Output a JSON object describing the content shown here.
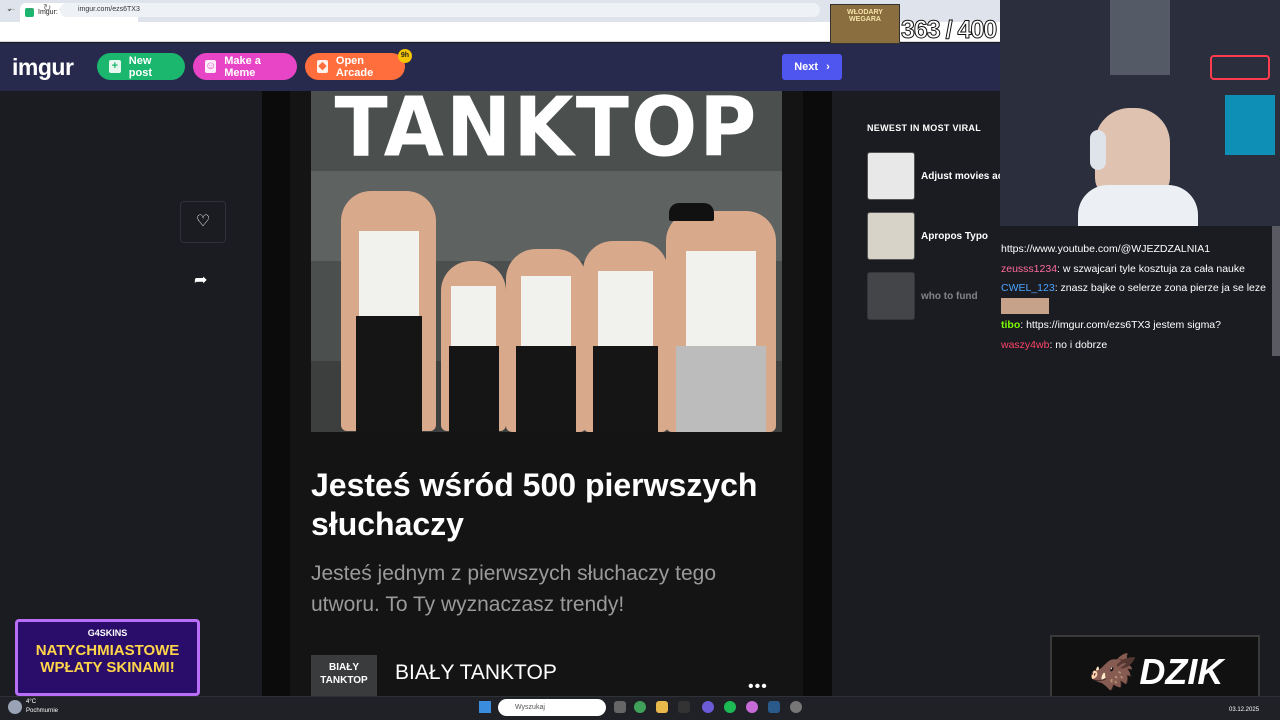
{
  "browser": {
    "tab_title": "Imgur: The magic of the Internet",
    "tab_close": "✕",
    "new_tab": "+",
    "url": "imgur.com/ezs6TX3"
  },
  "imgur": {
    "logo": "imgur",
    "new_post": "New post",
    "make_meme": "Make a Meme",
    "open_arcade": "Open Arcade",
    "arcade_badge": "9h",
    "next": "Next"
  },
  "post": {
    "image_title": "TANKTOP",
    "title": "Jesteś wśród 500 pierwszych słuchaczy",
    "description": "Jesteś jednym z pierwszych słuchaczy tego utworu. To Ty wyznaczasz trendy!",
    "track_art_text": "BIAŁY TANKTOP",
    "track_name": "BIAŁY TANKTOP",
    "more": "•••"
  },
  "sidebar": {
    "heading": "NEWEST IN MOST VIRAL",
    "items": [
      {
        "label": "Adjust movies ac"
      },
      {
        "label": "Apropos Typo"
      },
      {
        "label": "who to fund"
      }
    ]
  },
  "overlay": {
    "wardrobe": "WŁODARY WEGARA",
    "counter": "363 / 400",
    "chat": [
      {
        "user": "",
        "text": "https://www.youtube.com/@WJEZDZALNIA1",
        "color": "#ffffff"
      },
      {
        "user": "zeusss1234",
        "text": ": w szwajcari tyle kosztuja za cała nauke",
        "color": "#ff6b9a"
      },
      {
        "user": "CWEL_123",
        "text": ": znasz bajke o selerze zona pierze ja se leze",
        "color": "#4aa3ff"
      },
      {
        "user": "tibo",
        "text": ": https://imgur.com/ezs6TX3 jestem sigma?",
        "color": "#7cfc00"
      },
      {
        "user": "waszy4wb",
        "text": ": no i dobrze",
        "color": "#ff4466"
      }
    ],
    "promo_brand": "G4SKINS",
    "promo_line1": "NATYCHMIASTOWE",
    "promo_line2": "WPŁATY SKINAMI!",
    "dzik": "DZIK"
  },
  "taskbar": {
    "temp": "4°C",
    "weather": "Pochmurnie",
    "search": "Wyszukaj",
    "date": "03.12.2025"
  },
  "colors": {
    "imgur_header": "#27294d",
    "new_post": "#1bb76e",
    "make_meme": "#e745c5",
    "open_arcade": "#ff6e3c",
    "next": "#4f55ef"
  }
}
